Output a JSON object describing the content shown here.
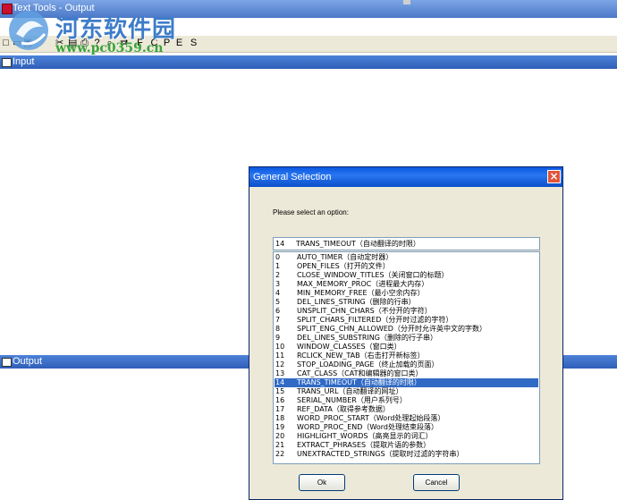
{
  "window": {
    "title": "Text Tools - Output"
  },
  "watermark": {
    "title": "河东软件园",
    "url": "www.pc0359.cn"
  },
  "toolbar": {
    "letters": [
      "F",
      "C",
      "P",
      "E",
      "S"
    ]
  },
  "panels": {
    "input_label": "Input",
    "output_label": "Output"
  },
  "dialog": {
    "title": "General Selection",
    "prompt": "Please select an option:",
    "selected": {
      "num": "14",
      "label": "TRANS_TIMEOUT（自动翻译的时限）"
    },
    "options": [
      {
        "num": "0",
        "label": "AUTO_TIMER（自动定时器）"
      },
      {
        "num": "1",
        "label": "OPEN_FILES（打开的文件）"
      },
      {
        "num": "2",
        "label": "CLOSE_WINDOW_TITLES（关闭窗口的标题）"
      },
      {
        "num": "3",
        "label": "MAX_MEMORY_PROC（进程最大内存）"
      },
      {
        "num": "4",
        "label": "MIN_MEMORY_FREE（最小空余内存）"
      },
      {
        "num": "5",
        "label": "DEL_LINES_STRING（删除的行串）"
      },
      {
        "num": "6",
        "label": "UNSPLIT_CHN_CHARS（不分开的字符）"
      },
      {
        "num": "7",
        "label": "SPLIT_CHARS_FILTERED（分开时过滤的字符）"
      },
      {
        "num": "8",
        "label": "SPLIT_ENG_CHN_ALLOWED（分开时允许英中文的字数）"
      },
      {
        "num": "9",
        "label": "DEL_LINES_SUBSTRING（删除的行子串）"
      },
      {
        "num": "10",
        "label": "WINDOW_CLASSES（窗口类）"
      },
      {
        "num": "11",
        "label": "RCLICK_NEW_TAB（右击打开新标签）"
      },
      {
        "num": "12",
        "label": "STOP_LOADING_PAGE（终止加载的页面）"
      },
      {
        "num": "13",
        "label": "CAT_CLASS（CAT和编辑器的窗口类）"
      },
      {
        "num": "14",
        "label": "TRANS_TIMEOUT（自动翻译的时限）"
      },
      {
        "num": "15",
        "label": "TRANS_URL（自动翻译的网址）"
      },
      {
        "num": "16",
        "label": "SERIAL_NUMBER（用户系列号）"
      },
      {
        "num": "17",
        "label": "REF_DATA（取得参考数据）"
      },
      {
        "num": "18",
        "label": "WORD_PROC_START（Word处理起始段落）"
      },
      {
        "num": "19",
        "label": "WORD_PROC_END（Word处理结束段落）"
      },
      {
        "num": "20",
        "label": "HIGHLIGHT_WORDS（高亮显示的词汇）"
      },
      {
        "num": "21",
        "label": "EXTRACT_PHRASES（提取片语的参数）"
      },
      {
        "num": "22",
        "label": "UNEXTRACTED_STRINGS（提取时过滤的字符串）"
      }
    ],
    "selected_index": 14,
    "ok_label": "Ok",
    "cancel_label": "Cancel"
  }
}
